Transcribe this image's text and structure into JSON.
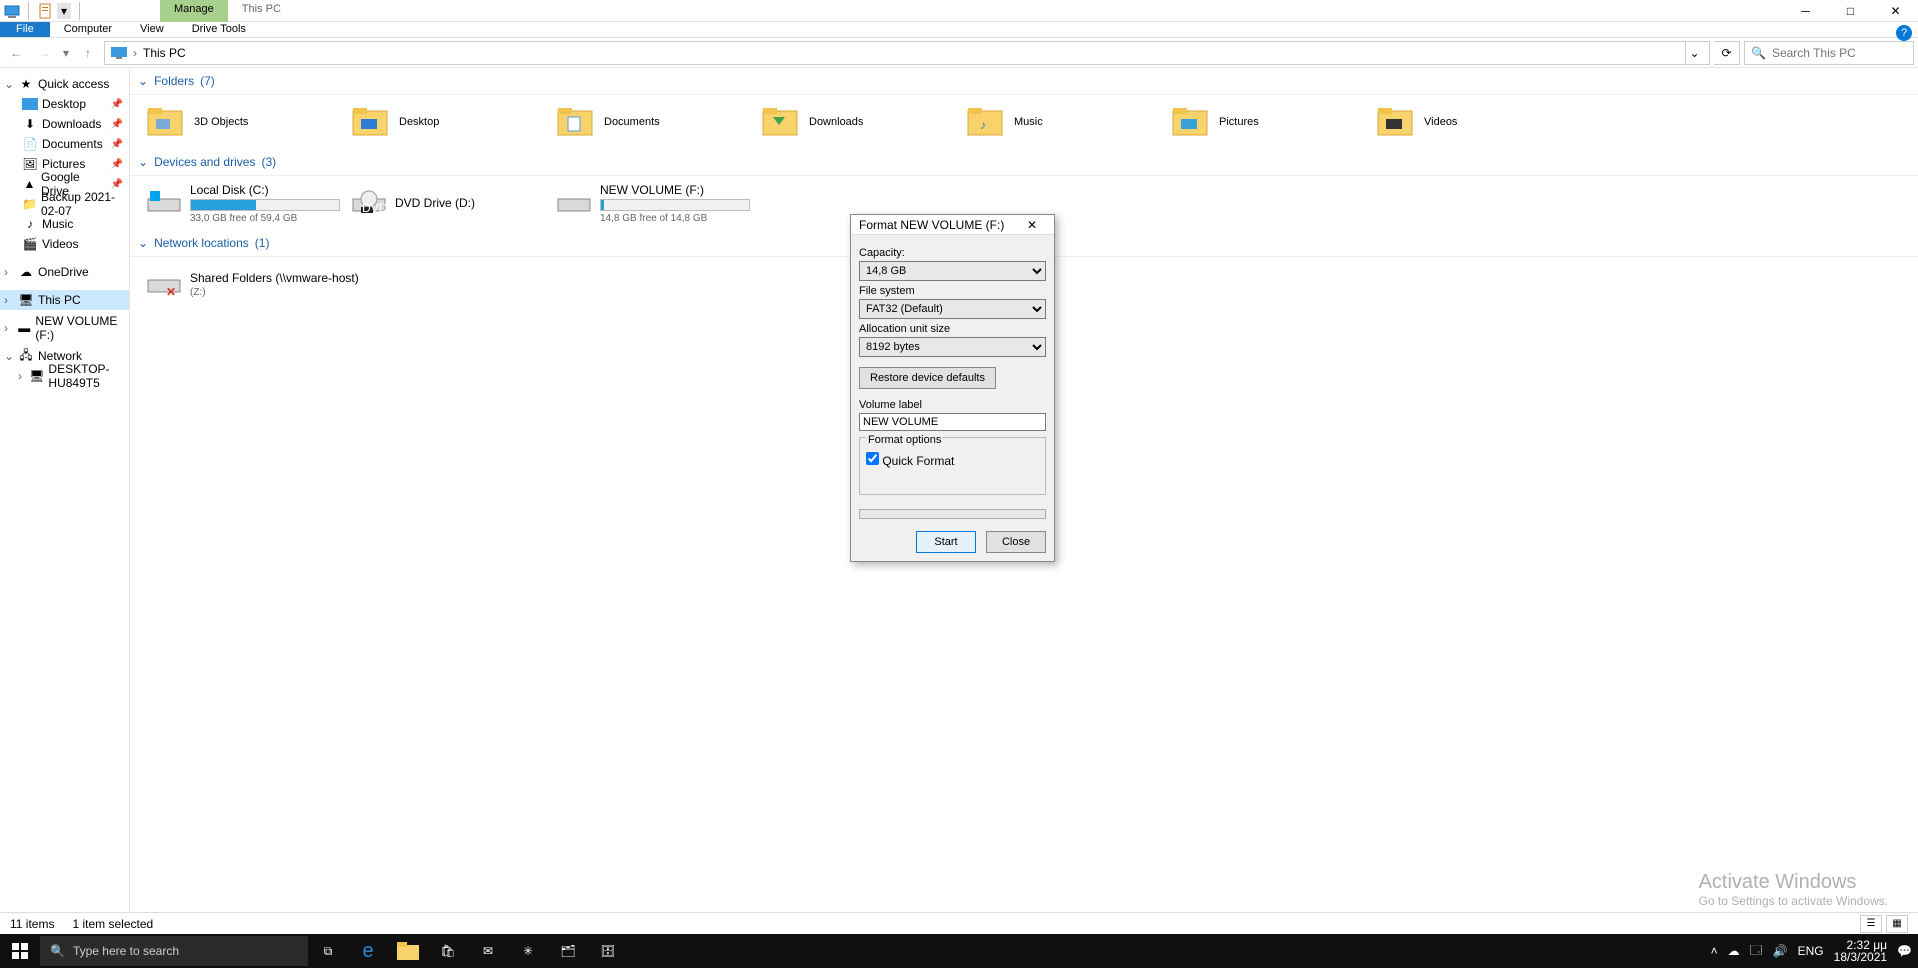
{
  "title": {
    "context_tab": "Manage",
    "inactive_tab": "This PC"
  },
  "ribbon": {
    "file": "File",
    "tabs": [
      "Computer",
      "View",
      "Drive Tools"
    ]
  },
  "address": {
    "location": "This PC",
    "search_placeholder": "Search This PC"
  },
  "nav": {
    "quick": "Quick access",
    "quick_items": [
      "Desktop",
      "Downloads",
      "Documents",
      "Pictures",
      "Google Drive",
      "Backup 2021-02-07",
      "Music",
      "Videos"
    ],
    "onedrive": "OneDrive",
    "thispc": "This PC",
    "newvol": "NEW VOLUME (F:)",
    "network": "Network",
    "desktop_pc": "DESKTOP-HU849T5"
  },
  "groups": {
    "folders": {
      "label": "Folders",
      "count": "(7)",
      "items": [
        "3D Objects",
        "Desktop",
        "Documents",
        "Downloads",
        "Music",
        "Pictures",
        "Videos"
      ]
    },
    "drives": {
      "label": "Devices and drives",
      "count": "(3)",
      "items": [
        {
          "name": "Local Disk (C:)",
          "sub": "33,0 GB free of 59,4 GB",
          "fill": 44
        },
        {
          "name": "DVD Drive (D:)",
          "sub": "",
          "fill": -1
        },
        {
          "name": "NEW VOLUME (F:)",
          "sub": "14,8 GB free of 14,8 GB",
          "fill": 2
        }
      ]
    },
    "network": {
      "label": "Network locations",
      "count": "(1)",
      "items": [
        {
          "name": "Shared Folders (\\\\vmware-host)",
          "sub": "(Z:)"
        }
      ]
    }
  },
  "status": {
    "count": "11 items",
    "sel": "1 item selected"
  },
  "watermark": {
    "t1": "Activate Windows",
    "t2": "Go to Settings to activate Windows."
  },
  "dlg": {
    "title": "Format NEW VOLUME (F:)",
    "cap_lbl": "Capacity:",
    "cap_val": "14,8 GB",
    "fs_lbl": "File system",
    "fs_val": "FAT32 (Default)",
    "au_lbl": "Allocation unit size",
    "au_val": "8192 bytes",
    "restore": "Restore device defaults",
    "vl_lbl": "Volume label",
    "vl_val": "NEW VOLUME",
    "fo_legend": "Format options",
    "qf": "Quick Format",
    "start": "Start",
    "close": "Close"
  },
  "taskbar": {
    "search_ph": "Type here to search",
    "lang": "ENG",
    "time": "2:32 μμ",
    "date": "18/3/2021"
  }
}
